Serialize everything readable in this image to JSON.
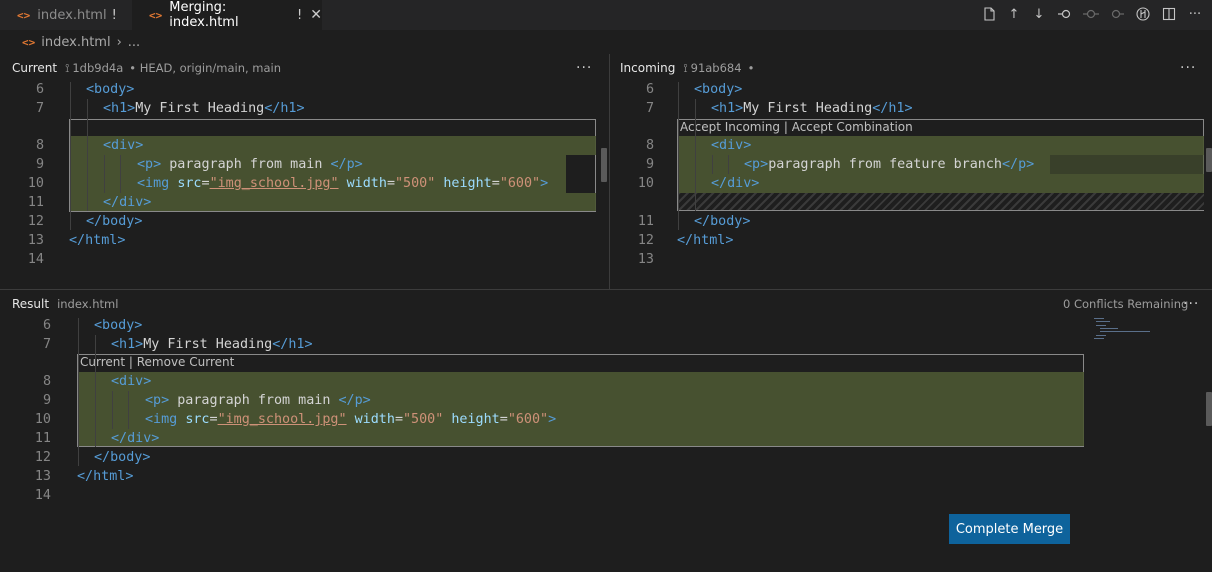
{
  "tabs": [
    {
      "label": "index.html",
      "modified": "!",
      "active": false
    },
    {
      "label": "Merging: index.html",
      "modified": "!",
      "active": true
    }
  ],
  "breadcrumb": {
    "file": "index.html",
    "more": "..."
  },
  "current": {
    "title": "Current",
    "commit": "1db9d4a",
    "refs": "• HEAD, origin/main, main"
  },
  "incoming": {
    "title": "Incoming",
    "commit": "91ab684",
    "refs": "•",
    "actions": "Accept Incoming | Accept Combination"
  },
  "result": {
    "title": "Result",
    "file": "index.html",
    "status": "0 Conflicts Remaining",
    "actions": "Current | Remove Current"
  },
  "buttons": {
    "complete_merge": "Complete Merge"
  },
  "code": {
    "body_open": "<body>",
    "h1": {
      "open": "<h1>",
      "text": "My First Heading",
      "close": "</h1>"
    },
    "div_open": "<div>",
    "div_close": "</div>",
    "p_main": {
      "open": "<p>",
      "text": " paragraph from main ",
      "close": "</p>"
    },
    "p_feature": {
      "open": "<p>",
      "text": "paragraph from feature branch",
      "close": "</p>"
    },
    "img": {
      "tag": "<img",
      "src_attr": "src",
      "src_val": "\"img_school.jpg\"",
      "w_attr": "width",
      "w_val": "\"500\"",
      "h_attr": "height",
      "h_val": "\"600\"",
      "close": ">"
    },
    "body_close": "</body>",
    "html_close": "</html>",
    "eq": "="
  },
  "line_numbers": {
    "current": [
      "6",
      "7",
      "8",
      "9",
      "10",
      "11",
      "12",
      "13",
      "14"
    ],
    "incoming": [
      "6",
      "7",
      "8",
      "9",
      "10",
      "11",
      "12",
      "13"
    ],
    "result": [
      "6",
      "7",
      "8",
      "9",
      "10",
      "11",
      "12",
      "13",
      "14"
    ]
  }
}
